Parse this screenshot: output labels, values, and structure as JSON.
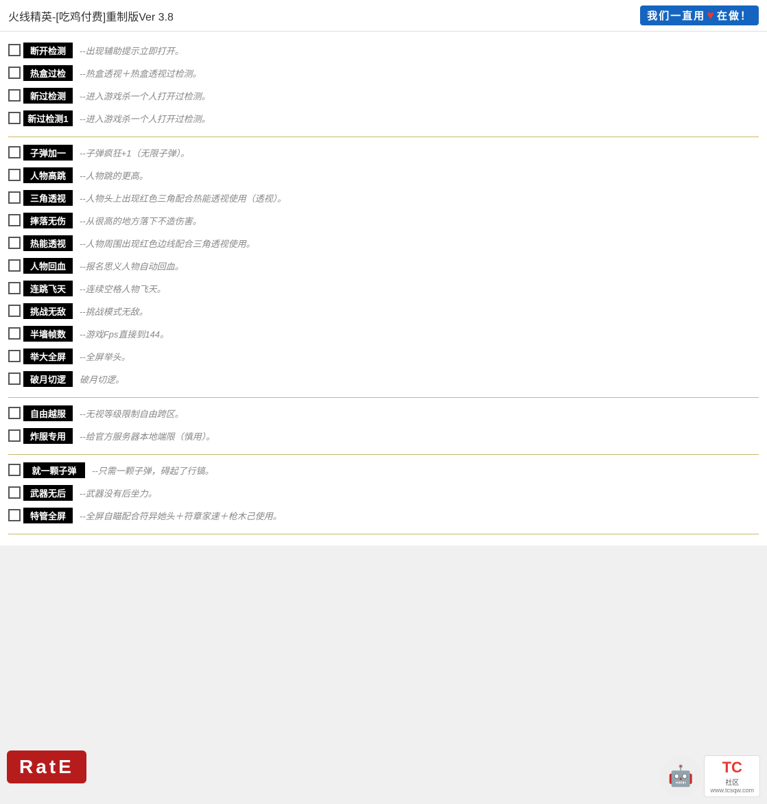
{
  "header": {
    "title": "火线精英-[吃鸡付费]重制版Ver 3.8",
    "badge": {
      "prefix": "我们一直用",
      "heart": "♥",
      "suffix": "在做！"
    }
  },
  "sections": [
    {
      "id": "section1",
      "items": [
        {
          "label": "断开检测",
          "desc": "--出现辅助提示立即打开。"
        },
        {
          "label": "热盒过检",
          "desc": "--热盒透视＋热盒透视过检测。"
        },
        {
          "label": "新过检测",
          "desc": "--进入游戏杀一个人打开过检测。"
        },
        {
          "label": "新过检测1",
          "desc": "--进入游戏杀一个人打开过检测。"
        }
      ]
    },
    {
      "id": "section2",
      "items": [
        {
          "label": "子弹加一",
          "desc": "--子弹疯狂+1（无限子弹）。"
        },
        {
          "label": "人物高跳",
          "desc": "--人物跳的更高。"
        },
        {
          "label": "三角透视",
          "desc": "--人物头上出现红色三角配合热能透视使用（透视）。"
        },
        {
          "label": "摔落无伤",
          "desc": "--从很高的地方落下不造伤害。"
        },
        {
          "label": "热能透视",
          "desc": "--人物周围出现红色边线配合三角透视使用。"
        },
        {
          "label": "人物回血",
          "desc": "--报名思义人物自动回血。"
        },
        {
          "label": "连跳飞天",
          "desc": "--连续空格人物飞天。"
        },
        {
          "label": "挑战无敌",
          "desc": "--挑战模式无敌。"
        },
        {
          "label": "半墙帧数",
          "desc": "--游戏Fps直接到144。"
        },
        {
          "label": "举大全屏",
          "desc": "--全屏举头。"
        },
        {
          "label": "破月切逻",
          "desc": "破月切逻。"
        }
      ]
    },
    {
      "id": "section3",
      "items": [
        {
          "label": "自由越服",
          "desc": "--无视等级限制自由跨区。"
        },
        {
          "label": "炸服专用",
          "desc": "--给官方服务器本地端限（慎用）。"
        }
      ]
    },
    {
      "id": "section4",
      "items": [
        {
          "label": "就一颗子弹",
          "desc": "--只需一颗子弹，碍起了行镐。"
        },
        {
          "label": "武器无后",
          "desc": "--武器没有后坐力。"
        },
        {
          "label": "特管全屏",
          "desc": "--全屏自瞄配合符异她头＋符章家速＋枪木己使用。"
        }
      ]
    }
  ],
  "watermark": {
    "site": "www.tcsqw.com",
    "logo": "TC社区"
  },
  "rate_badge": "RatE"
}
